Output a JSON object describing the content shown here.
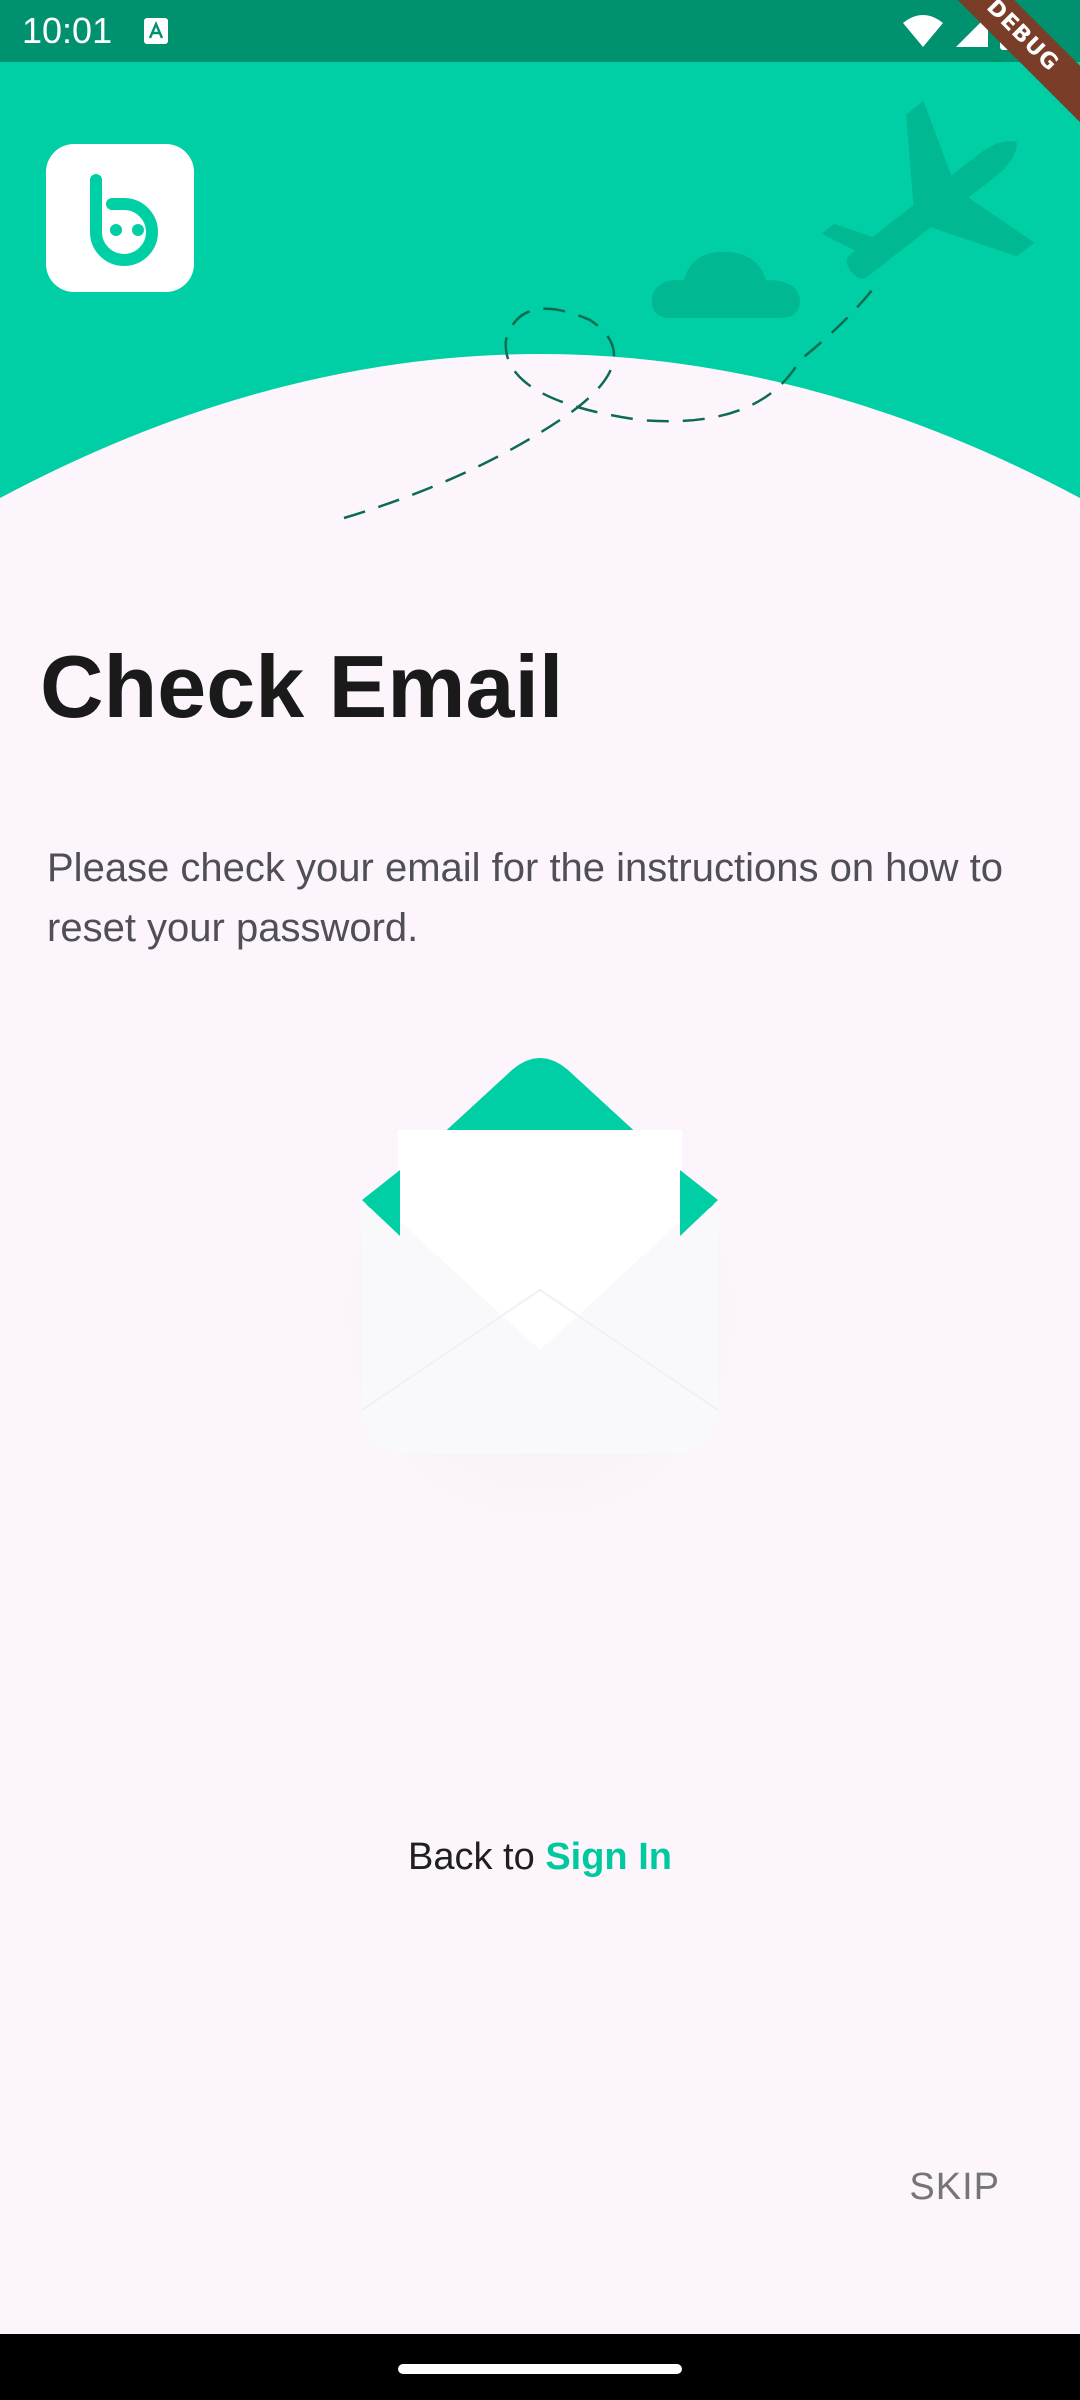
{
  "status_bar": {
    "time": "10:01",
    "background": "#00916f",
    "icons": [
      "text-input-icon",
      "wifi-icon",
      "signal-icon",
      "battery-icon"
    ]
  },
  "debug_banner": {
    "label": "DEBUG",
    "color": "#7a3d28"
  },
  "header": {
    "background": "#00cea4",
    "illustration": [
      "logo-icon",
      "cloud-icon",
      "airplane-icon",
      "dashed-flight-path"
    ]
  },
  "content": {
    "title": "Check Email",
    "message": "Please check your email for the instructions on how to reset your password.",
    "illustration": "envelope-icon"
  },
  "footer": {
    "back_prefix": "Back to ",
    "sign_in_label": "Sign In",
    "skip_label": "SKIP"
  },
  "colors": {
    "accent": "#00cea4",
    "page_background": "#fcf6fc",
    "title_text": "#1a1a1a",
    "body_text": "#4f4f55",
    "link": "#00c9a0"
  }
}
